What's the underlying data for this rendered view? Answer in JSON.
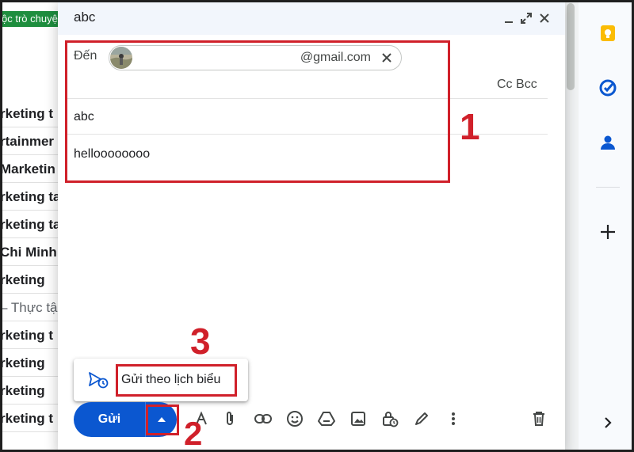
{
  "inbox": {
    "label_chip": "ộc trò chuyệ",
    "rows": [
      {
        "text": "rketing t",
        "bold": true
      },
      {
        "text": "rtainmer",
        "bold": true
      },
      {
        "text": "Marketin",
        "bold": true
      },
      {
        "text": "rketing ta",
        "bold": true
      },
      {
        "text": "rketing ta",
        "bold": true
      },
      {
        "text": "Chi Minh",
        "bold": true
      },
      {
        "text": "rketing",
        "bold": true
      },
      {
        "text": "– Thực tậ",
        "bold": false
      },
      {
        "text": "rketing t",
        "bold": true
      },
      {
        "text": "rketing",
        "bold": true
      },
      {
        "text": "rketing",
        "bold": true
      },
      {
        "text": "rketing t",
        "bold": true
      }
    ]
  },
  "compose": {
    "title": "abc",
    "to_label": "Đến",
    "recipient_email": "@gmail.com",
    "cc_label": "Cc",
    "bcc_label": "Bcc",
    "subject": "abc",
    "body": "helloooooooo",
    "send_label": "Gửi",
    "schedule_label": "Gửi theo lịch biểu"
  },
  "annotations": {
    "step1": "1",
    "step2": "2",
    "step3": "3"
  },
  "colors": {
    "annotation": "#d0202a",
    "send_button": "#0b57d0",
    "header_bg": "#f2f6fc",
    "label_chip": "#1e8e3e"
  },
  "icons": {
    "header": [
      "minimize-icon",
      "expand-icon",
      "close-icon"
    ],
    "toolbar": [
      "format-text-icon",
      "attach-icon",
      "link-icon",
      "emoji-icon",
      "drive-icon",
      "photo-icon",
      "confidential-lock-icon",
      "signature-pen-icon",
      "more-options-icon",
      "trash-icon"
    ],
    "sidepanel": [
      "keep-icon",
      "tasks-icon",
      "contacts-icon",
      "add-icon",
      "chevron-right-icon"
    ]
  }
}
